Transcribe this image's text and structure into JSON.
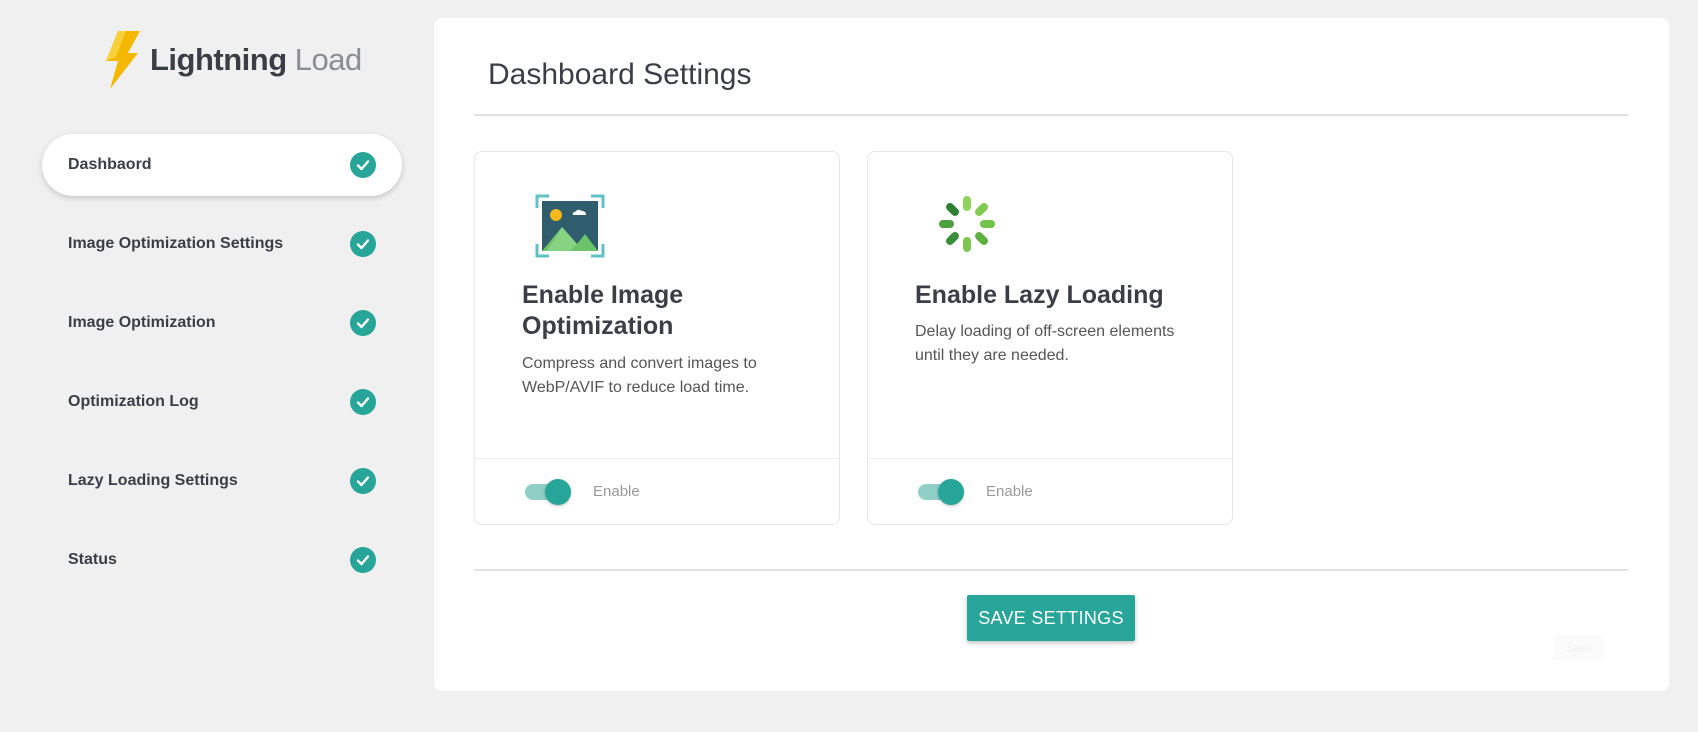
{
  "brand": {
    "name_part1": "Lightning",
    "name_part2": "Load"
  },
  "sidebar": {
    "items": [
      {
        "label": "Dashbaord",
        "active": true
      },
      {
        "label": "Image Optimization Settings",
        "active": false
      },
      {
        "label": "Image Optimization",
        "active": false
      },
      {
        "label": "Optimization Log",
        "active": false
      },
      {
        "label": "Lazy Loading Settings",
        "active": false
      },
      {
        "label": "Status",
        "active": false
      }
    ]
  },
  "main": {
    "title": "Dashboard Settings",
    "cards": [
      {
        "icon": "image-icon",
        "title": "Enable Image Optimization",
        "description": "Compress and convert images to WebP/AVIF to reduce load time.",
        "toggle_label": "Enable",
        "enabled": true
      },
      {
        "icon": "spinner-icon",
        "title": "Enable Lazy Loading",
        "description": "Delay loading of off-screen elements until they are needed.",
        "toggle_label": "Enable",
        "enabled": true
      }
    ],
    "save_label": "SAVE SETTINGS",
    "ghost_label": "Save"
  },
  "colors": {
    "accent": "#26a598",
    "bolt": "#f5b800"
  }
}
